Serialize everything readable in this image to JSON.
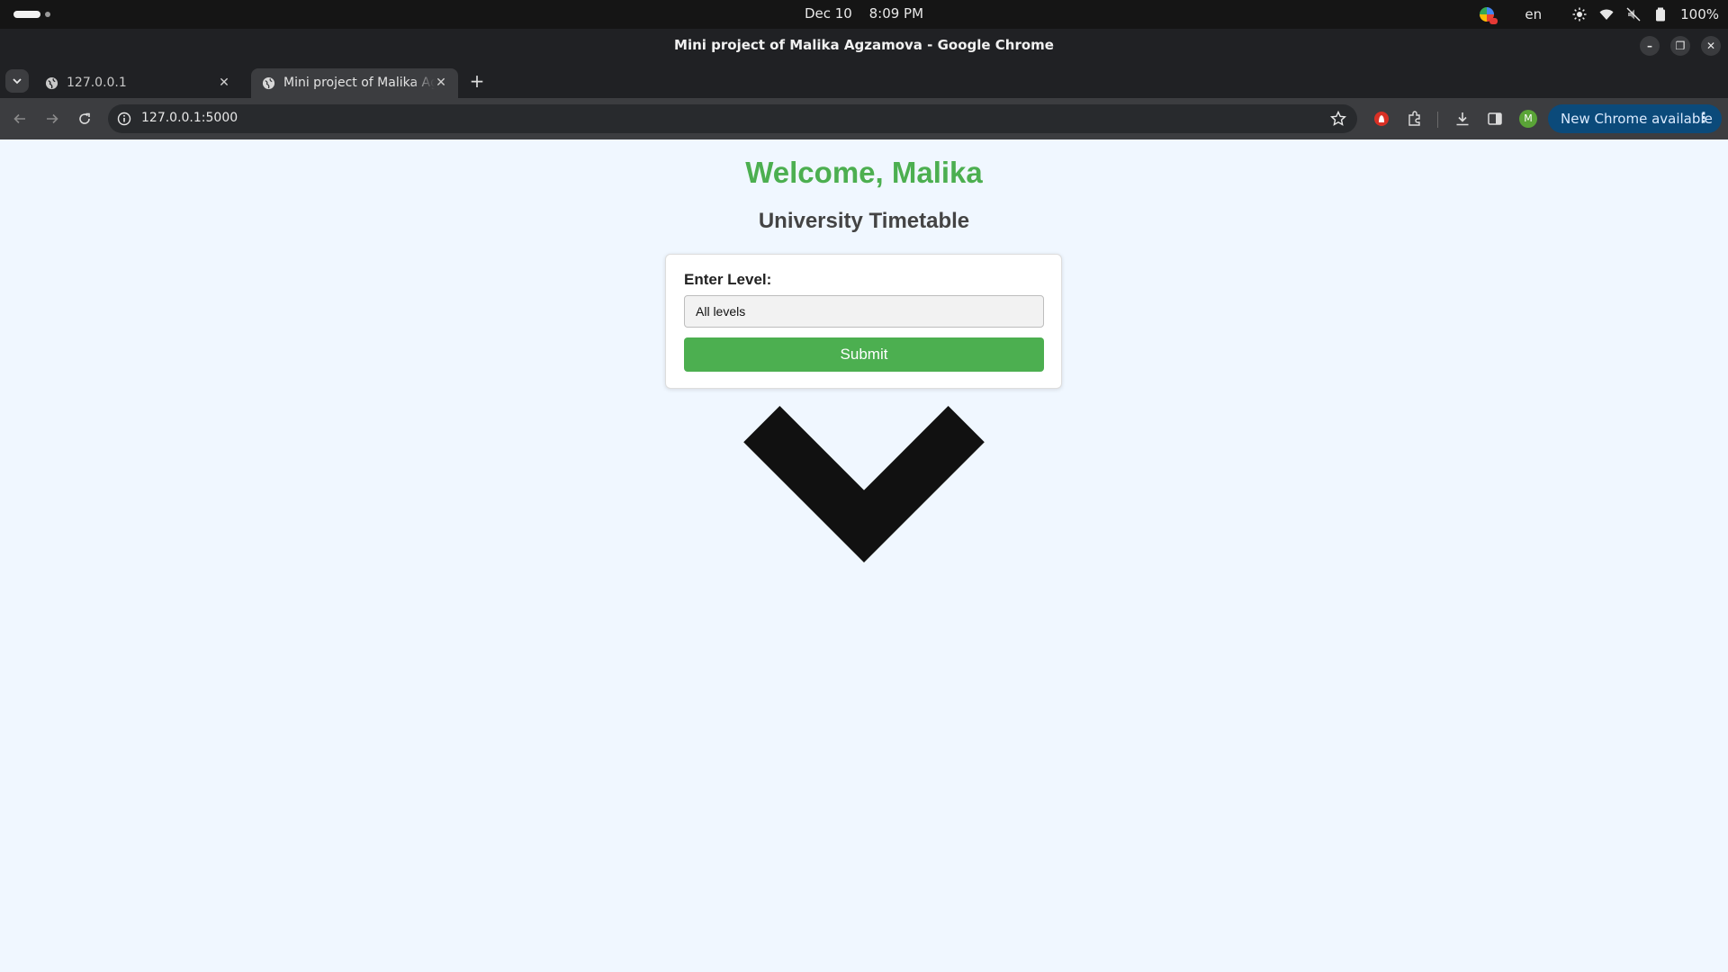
{
  "os": {
    "date": "Dec 10",
    "time": "8:09 PM",
    "language": "en",
    "battery": "100%",
    "icons": [
      "activities-indicator",
      "chrome-tray-icon",
      "brightness-icon",
      "wifi-icon",
      "volume-muted-icon",
      "battery-icon"
    ]
  },
  "window": {
    "title": "Mini project of Malika Agzamova - Google Chrome",
    "controls": [
      "minimize-icon",
      "restore-icon",
      "close-icon"
    ]
  },
  "tabs": [
    {
      "label": "127.0.0.1",
      "active": false,
      "icon": "globe-icon"
    },
    {
      "label": "Mini project of Malika Agzamova",
      "active": true,
      "icon": "globe-icon"
    }
  ],
  "toolbar": {
    "url": "127.0.0.1:5000",
    "avatar_letter": "M",
    "update_label": "New Chrome available",
    "update_color": "#0b4a7a"
  },
  "page": {
    "welcome": "Welcome, Malika",
    "subtitle": "University Timetable",
    "form": {
      "label": "Enter Level:",
      "selected_value": "All levels",
      "submit_label": "Submit"
    },
    "colors": {
      "accent": "#4caf50",
      "background": "#f0f7ff"
    }
  }
}
